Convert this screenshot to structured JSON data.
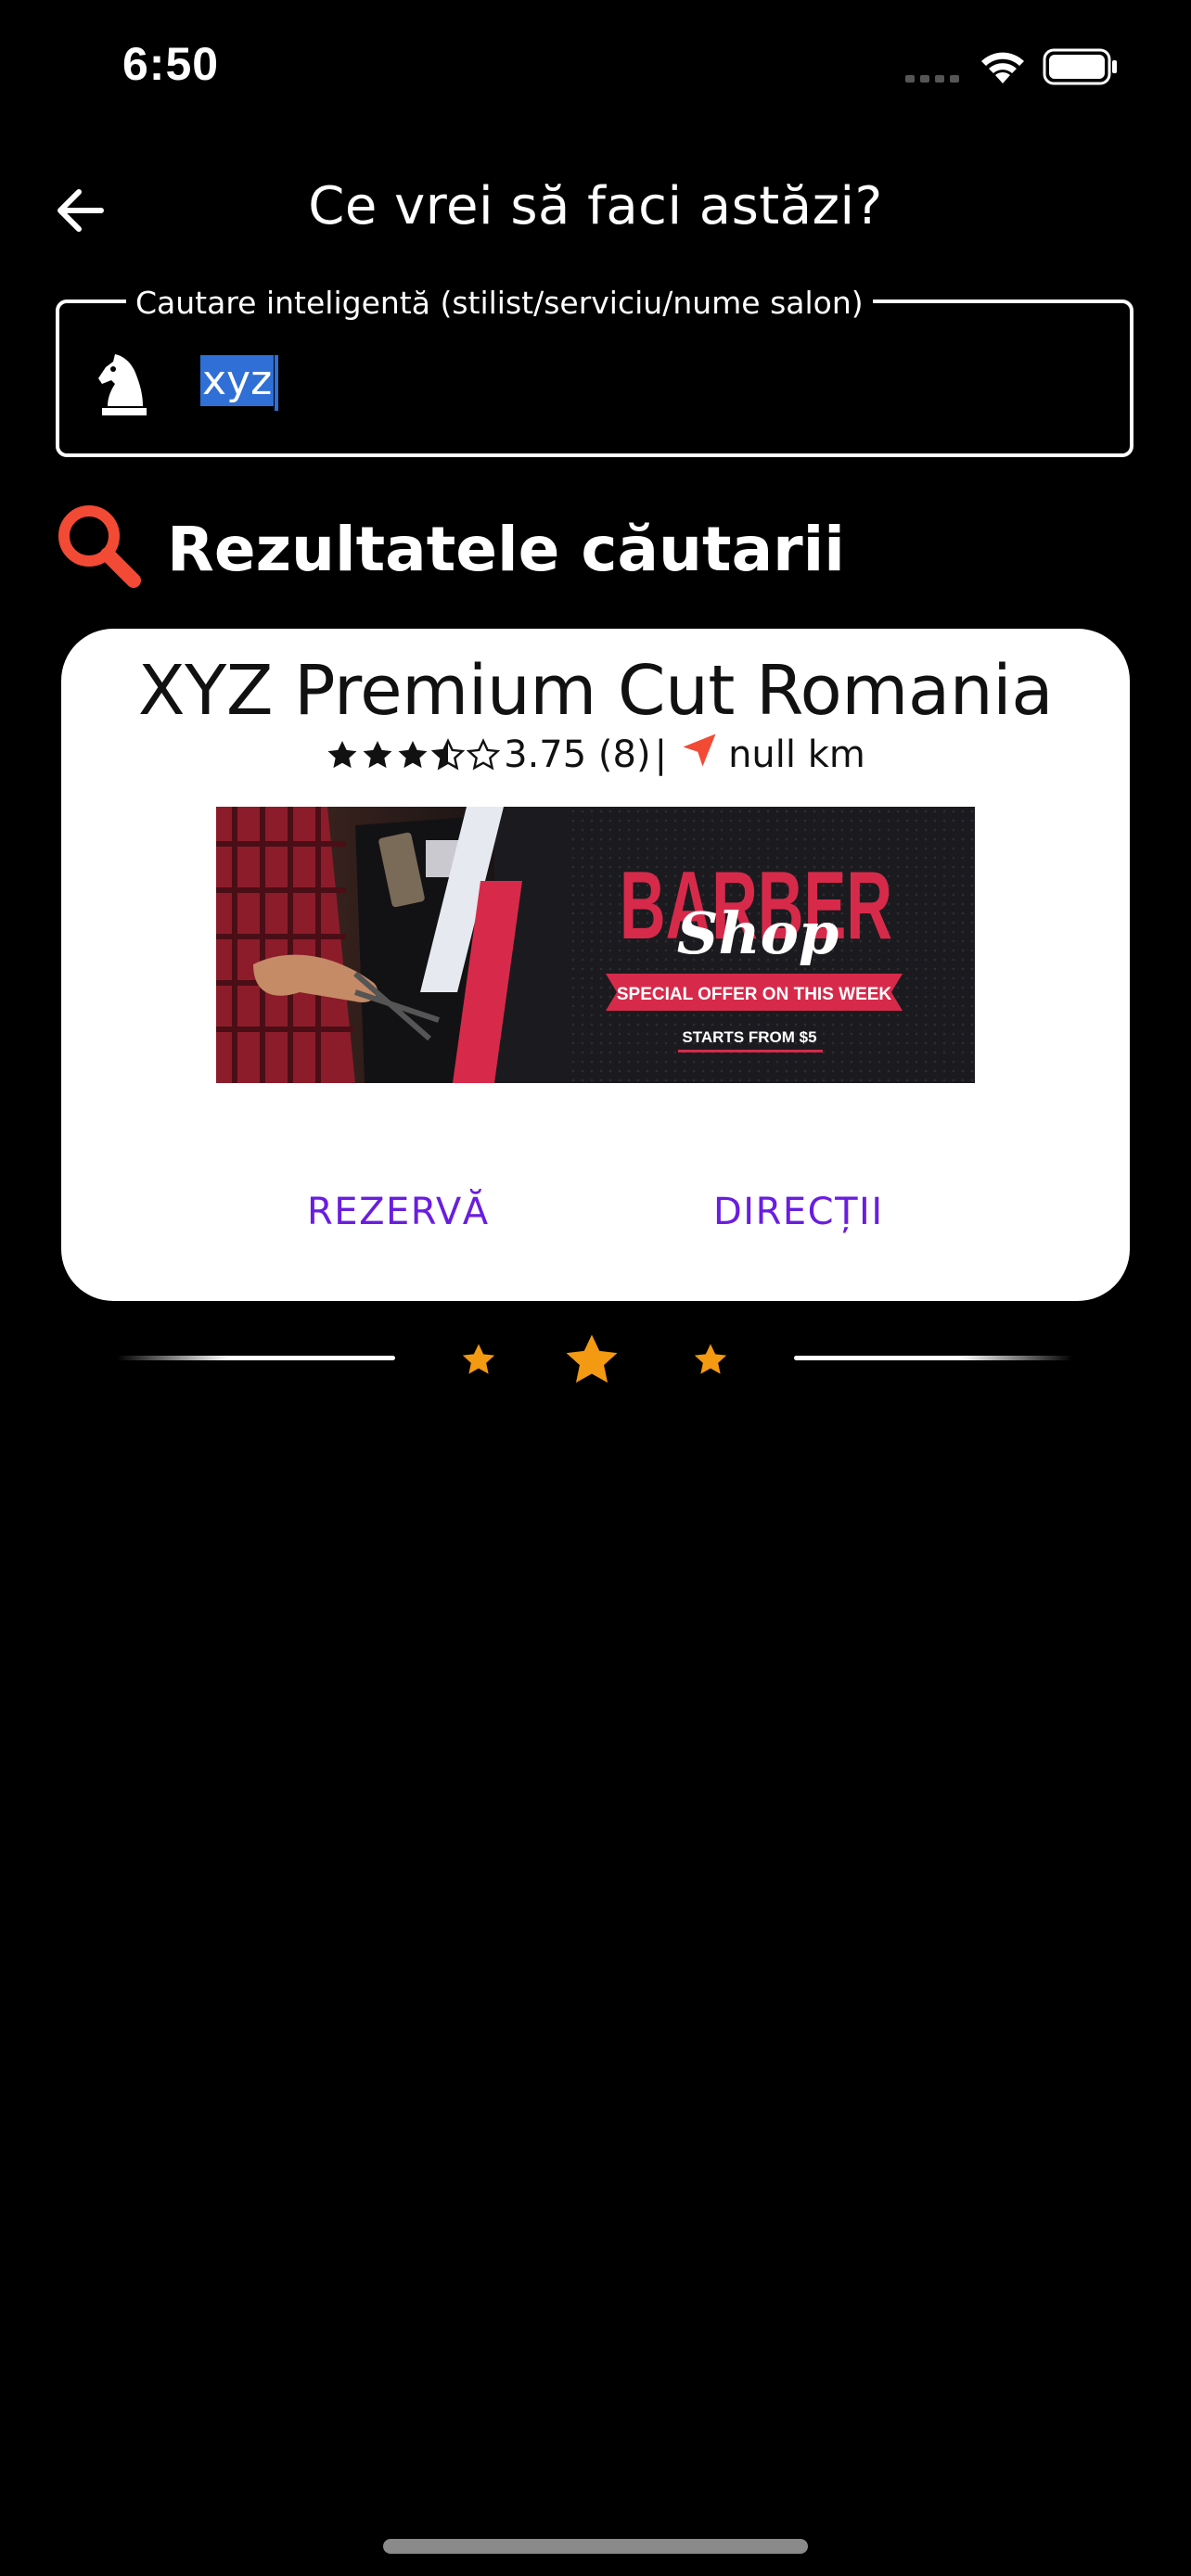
{
  "status_bar": {
    "time": "6:50"
  },
  "header": {
    "title": "Ce vrei să faci astăzi?",
    "back_icon": "arrow-left-icon"
  },
  "search": {
    "label": "Cautare inteligentă (stilist/serviciu/nume salon)",
    "value": "xyz",
    "icon": "chess-knight-icon"
  },
  "results": {
    "heading": "Rezultatele căutarii",
    "icon": "magnifier-icon",
    "icon_color": "#f24a34",
    "items": [
      {
        "name": "XYZ Premium Cut Romania",
        "rating": 3.75,
        "rating_text": "3.75 (8)",
        "separator": "|",
        "distance_text": "null km",
        "banner": {
          "brand_line1": "BARBER",
          "brand_line2": "Shop",
          "ribbon": "SPECIAL OFFER ON THIS WEEK",
          "price_note": "STARTS FROM $5"
        },
        "actions": {
          "book_label": "REZERVĂ",
          "directions_label": "DIRECȚII"
        }
      }
    ]
  },
  "colors": {
    "background": "#000000",
    "card": "#ffffff",
    "action": "#6a1de0",
    "accent_red": "#f24a34",
    "divider_star": "#f39a12",
    "selection": "#2f6fd6"
  }
}
